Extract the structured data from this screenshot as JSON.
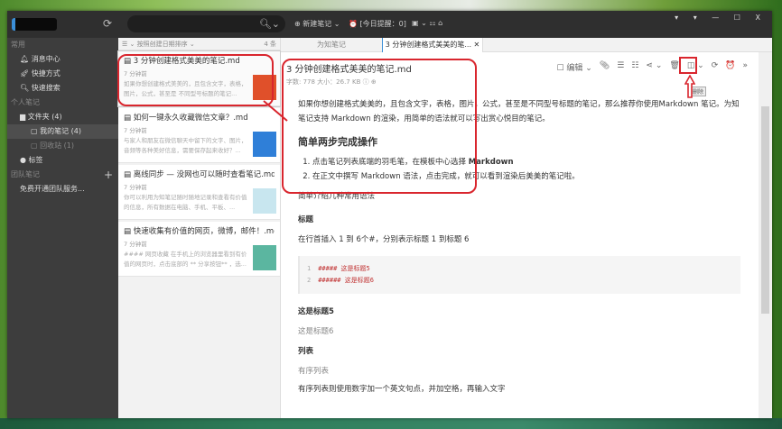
{
  "titlebar": {
    "search_icon": "🔍︎⌄",
    "new_note": "⊕ 新建笔记 ⌄",
    "today_reminder": "⏰ [今日提醒：0]",
    "more": "▣ ⌄  ⚏  ⌂",
    "window_controls": "▾ ▾ — ☐ X"
  },
  "sidebar": {
    "sections": [
      {
        "label": "常用"
      },
      {
        "label": "个人笔记"
      },
      {
        "label": "团队笔记"
      }
    ],
    "common": [
      {
        "icon": "bell-icon",
        "label": "🔔︎ 消息中心"
      },
      {
        "icon": "rocket-icon",
        "label": "🚀︎ 快捷方式"
      },
      {
        "icon": "search-icon",
        "label": "🔍︎ 快速搜索"
      }
    ],
    "folders": {
      "root": "▆ 文件夹 (4)",
      "mine": "▢ 我的笔记 (4)",
      "trash": "▢ 回收站 (1)",
      "tags": "● 标签"
    },
    "team_plus": "+",
    "team_service": "免费开通团队服务..."
  },
  "notelist": {
    "sort": "☰ ⌄ 按照创建日期排序 ⌄",
    "count": "4 条",
    "notes": [
      {
        "title": "▤ 3 分钟创建格式美美的笔记.md",
        "time": "7 分钟前",
        "snippet": "如果你想创建格式美美的，且包含文字，表格，图片，公式，甚至是 不同型号标题的笔记...",
        "thumb": "#e0502a"
      },
      {
        "title": "▤ 如何一键永久收藏微信文章？.md",
        "time": "7 分钟前",
        "snippet": "与家人和朋友在微信聊天中留下的文字、图片，音频等各种美好信息，需要保存起来收好？...",
        "thumb": "#2f7fd8"
      },
      {
        "title": "▤ 离线同步 — 没网也可以随时查看笔记.md",
        "time": "7 分钟前",
        "snippet": "你可以利用为知笔记随时随地记录和查看有价值的信息，所有数据在电脑、手机、平板、...",
        "thumb": "#c8e6ef"
      },
      {
        "title": "▤ 快速收集有价值的网页，微博，邮件！.md",
        "time": "7 分钟前",
        "snippet": "#### 网页收藏 在手机上的浏览器里看到有价值的网页时，点击底部的 ** 分享按钮** ，选...",
        "thumb": "#5bb6a0"
      }
    ]
  },
  "tabs": [
    {
      "label": "为知笔记"
    },
    {
      "label": "3 分钟创建格式美美的笔... ✕"
    }
  ],
  "note": {
    "title": "3 分钟创建格式美美的笔记.md",
    "meta": "字数: 778    大小：26.7 KB   ⓘ   ⊕",
    "toolbar": {
      "edit": "☐ 编辑 ⌄",
      "attach": "📎︎",
      "comment": "☰",
      "history": "☷",
      "share": "⋖ ⌄",
      "delete": "🗑︎",
      "layout": "◫ ⌄",
      "sync": "⟳",
      "reminder": "⏰",
      "more": "»"
    },
    "tooltip": "删除",
    "intro": "如果你想创建格式美美的，且包含文字，表格，图片，公式，甚至是不同型号标题的笔记，那么推荐你使用Markdown 笔记。为知笔记支持 Markdown 的渲染，用简单的语法就可以写出赏心悦目的笔记。",
    "h_steps": "简单两步完成操作",
    "step1_pre": "点击笔记列表底端的羽毛笔，在模板中心选择 ",
    "step1_bold": "Markdown",
    "step2": "在正文中撰写 Markdown 语法，点击完成，就可以看到渲染后美美的笔记啦。",
    "syntax_intro": "简单介绍几种常用语法",
    "h_heading": "标题",
    "heading_desc": "在行首插入 1 到 6个#，分别表示标题 1 到标题 6",
    "code": [
      {
        "n": "1",
        "text": "##### 这是标题5"
      },
      {
        "n": "2",
        "text": "###### 这是标题6"
      }
    ],
    "h5": "这是标题5",
    "h6": "这是标题6",
    "h_list": "列表",
    "ordered": "有序列表",
    "ordered_desc": "有序列表则使用数字加一个英文句点，并加空格，再输入文字"
  }
}
